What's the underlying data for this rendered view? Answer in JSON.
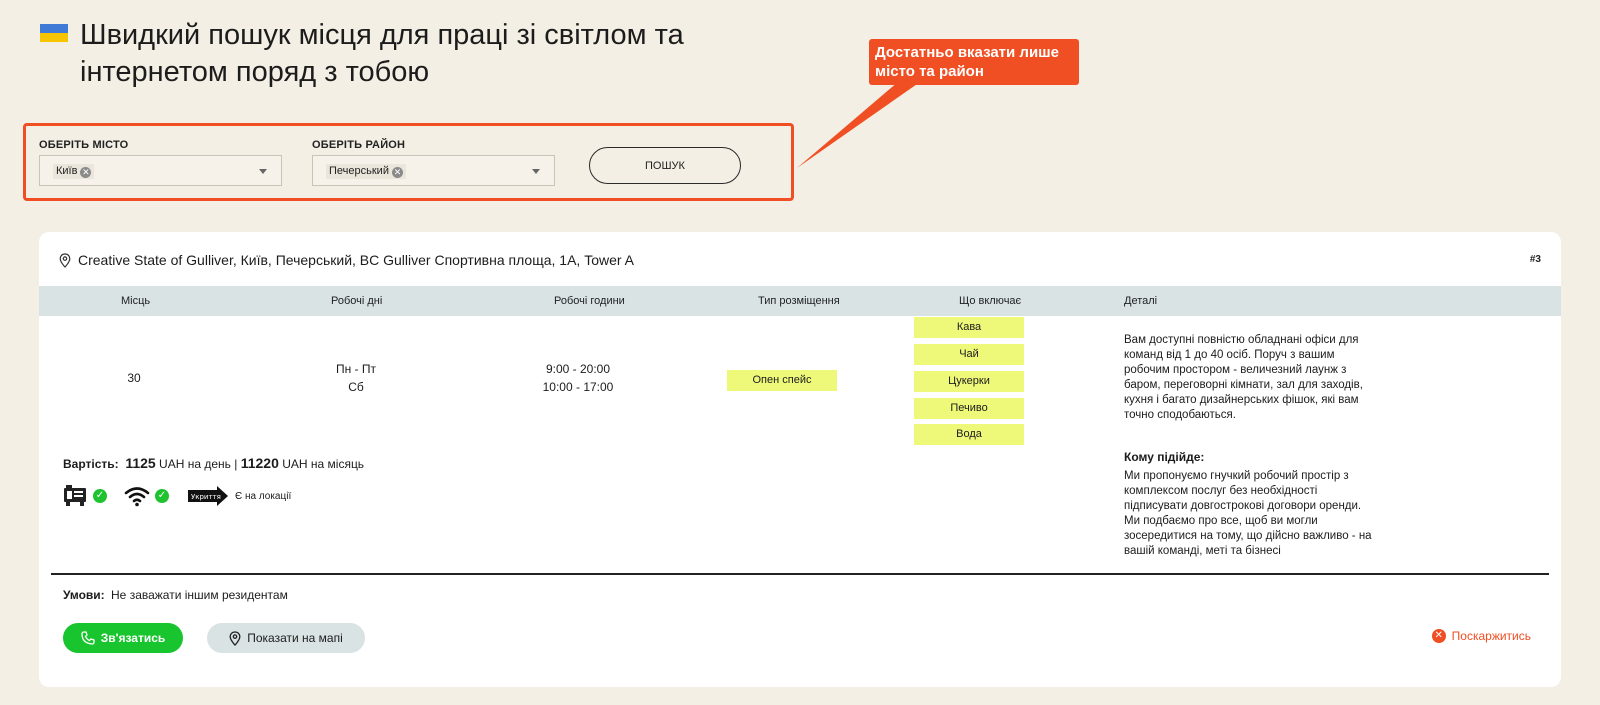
{
  "header": {
    "title_line1": "Швидкий пошук місця для праці зі світлом та",
    "title_line2": "інтернетом поряд з тобою",
    "flag_icon": "ukraine-flag-icon"
  },
  "callout": {
    "line1": "Достатньо вказати лише",
    "line2": "місто та район"
  },
  "search": {
    "city_label": "ОБЕРІТЬ МІСТО",
    "city_value": "Київ",
    "district_label": "ОБЕРІТЬ РАЙОН",
    "district_value": "Печерський",
    "button_label": "ПОШУК"
  },
  "listing": {
    "address": "Creative State of Gulliver, Київ, Печерський, BC Gulliver Спортивна площа, 1А, Tower A",
    "id": "#3",
    "columns": [
      "Місць",
      "Робочі дні",
      "Робочі години",
      "Тип розміщення",
      "Що включає",
      "Деталі"
    ],
    "seats": "30",
    "days_line1": "Пн - Пт",
    "days_line2": "Сб",
    "hours_line1": "9:00 - 20:00",
    "hours_line2": "10:00 - 17:00",
    "placement": "Опен спейс",
    "includes": [
      "Кава",
      "Чай",
      "Цукерки",
      "Печиво",
      "Вода"
    ],
    "details": "Вам доступні повністю обладнані офіси для команд від 1 до 40 осіб. Поруч з вашим робочим простором - величезний лаунж з баром, переговорні кімнати, зал для заходів, кухня і багато дизайнерських фішок, які вам точно сподобаються.",
    "suits_label": "Кому підійде:",
    "suits_text": "Ми пропонуємо гнучкий робочий простір з комплексом послуг без необхідності підписувати довгострокові договори оренди. Ми подбаємо про все, щоб ви могли зосередитися на тому, що дійсно важливо - на вашій команді, меті та бізнесі",
    "price_label": "Вартість:",
    "price_day": "1125",
    "price_day_unit": "UAH на день |",
    "price_month": "11220",
    "price_month_unit": "UAH на місяць",
    "shelter_sign": "Укриття",
    "shelter_text": "Є на локації",
    "terms_label": "Умови:",
    "terms_text": "Не заважати іншим резидентам",
    "contact_button": "Зв'язатись",
    "map_button": "Показати на мапі",
    "complain_button": "Поскаржитись"
  }
}
